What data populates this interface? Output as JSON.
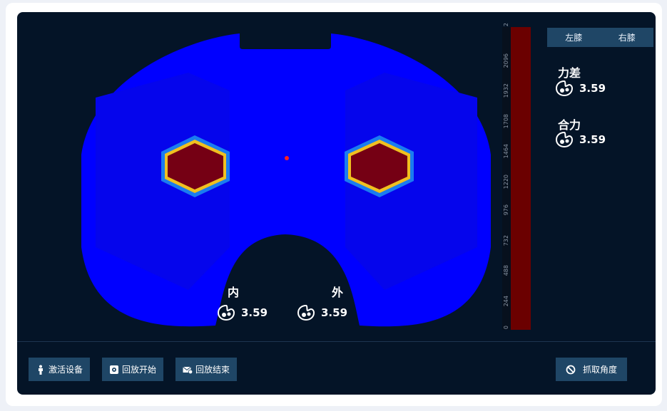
{
  "tabs": [
    "左膝",
    "右膝"
  ],
  "metrics": {
    "force_diff": {
      "label": "力差",
      "value": "3.59"
    },
    "resultant": {
      "label": "合力",
      "value": "3.59"
    },
    "medial": {
      "label": "内",
      "value": "3.59"
    },
    "lateral": {
      "label": "外",
      "value": "3.59"
    }
  },
  "scale_ticks": [
    "2",
    "2096",
    "1932",
    "1708",
    "1464",
    "1220",
    "976",
    "732",
    "488",
    "244",
    "0"
  ],
  "buttons": {
    "activate": "激活设备",
    "replay_start": "回放开始",
    "replay_end": "回放结束",
    "capture_angle": "抓取角度"
  },
  "colors": {
    "panel": "#041427",
    "implant": "#0000ff",
    "hotspot": "#750014",
    "accent": "#1f4666"
  }
}
